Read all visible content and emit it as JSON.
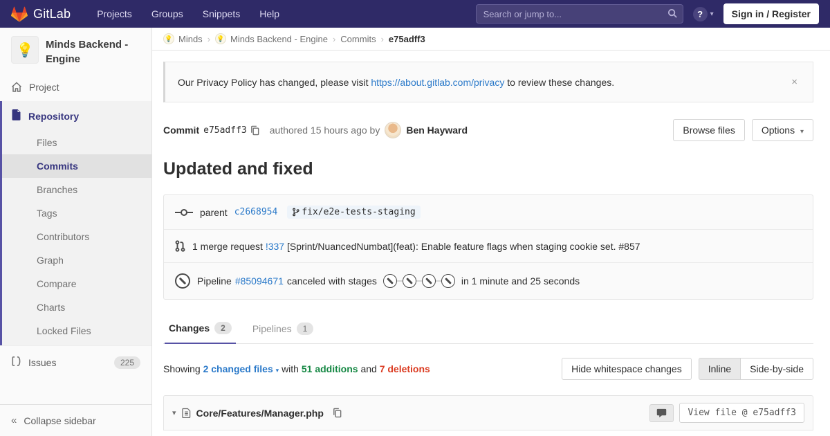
{
  "colors": {
    "navbar_bg": "#2f2a67",
    "accent_purple": "#5752a5",
    "link_blue": "#2a79c9",
    "additions_green": "#168844",
    "deletions_red": "#db3b21"
  },
  "navbar": {
    "brand": "GitLab",
    "menu": [
      {
        "label": "Projects"
      },
      {
        "label": "Groups"
      },
      {
        "label": "Snippets"
      },
      {
        "label": "Help"
      }
    ],
    "search_placeholder": "Search or jump to...",
    "help_glyph": "?",
    "sign_in_label": "Sign in / Register"
  },
  "sidebar": {
    "project_avatar_glyph": "💡",
    "project_name": "Minds Backend - Engine",
    "project_item": "Project",
    "repository_item": "Repository",
    "repo_sub_items": [
      {
        "label": "Files"
      },
      {
        "label": "Commits"
      },
      {
        "label": "Branches"
      },
      {
        "label": "Tags"
      },
      {
        "label": "Contributors"
      },
      {
        "label": "Graph"
      },
      {
        "label": "Compare"
      },
      {
        "label": "Charts"
      },
      {
        "label": "Locked Files"
      }
    ],
    "issues_label": "Issues",
    "issues_count": "225",
    "collapse_label": "Collapse sidebar",
    "collapse_glyph": "«"
  },
  "breadcrumb": {
    "items": [
      {
        "label": "Minds"
      },
      {
        "label": "Minds Backend - Engine"
      },
      {
        "label": "Commits"
      },
      {
        "label": "e75adff3"
      }
    ],
    "separator": "›",
    "avatar_glyph": "💡"
  },
  "banner": {
    "text_before": "Our Privacy Policy has changed, please visit ",
    "link": "https://about.gitlab.com/privacy",
    "text_after": " to review these changes.",
    "close_glyph": "×"
  },
  "commit": {
    "label": "Commit",
    "sha": "e75adff3",
    "authored_text": "authored 15 hours ago by",
    "author": "Ben Hayward",
    "browse_files_label": "Browse files",
    "options_label": "Options",
    "caret_glyph": "▾",
    "title": "Updated and fixed",
    "parent_label": "parent",
    "parent_sha": "c2668954",
    "branch_name": "fix/e2e-tests-staging",
    "mr_prefix": "1 merge request",
    "mr_link": "!337",
    "mr_title": "[Sprint/NuancedNumbat](feat): Enable feature flags when staging cookie set. #857",
    "pipeline_label": "Pipeline",
    "pipeline_id": "#85094671",
    "pipeline_status": "canceled with stages",
    "pipeline_stage_count": 4,
    "pipeline_duration": "in 1 minute and 25 seconds"
  },
  "tabs": [
    {
      "label": "Changes",
      "count": "2"
    },
    {
      "label": "Pipelines",
      "count": "1"
    }
  ],
  "diff": {
    "showing_label": "Showing",
    "changed_files": "2 changed files",
    "caret_glyph": "▾",
    "with_label": "with",
    "additions": "51 additions",
    "and_label": "and",
    "deletions": "7 deletions",
    "hide_whitespace_label": "Hide whitespace changes",
    "inline_label": "Inline",
    "side_by_side_label": "Side-by-side",
    "file_caret_glyph": "▾",
    "file_path": "Core/Features/Manager.php",
    "view_file_label": "View file @ e75adff3"
  }
}
